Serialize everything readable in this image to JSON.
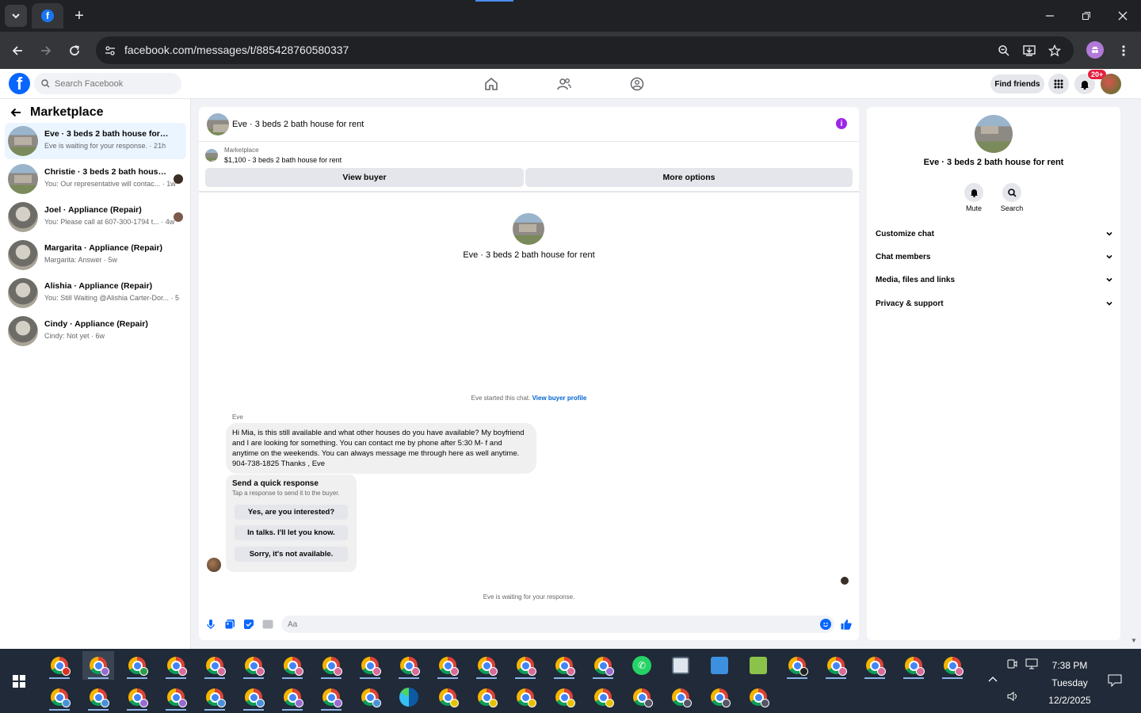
{
  "browser": {
    "url": "facebook.com/messages/t/885428760580337",
    "new_tab": "+"
  },
  "fb_header": {
    "search_placeholder": "Search Facebook",
    "find_friends": "Find friends",
    "notification_badge": "20+"
  },
  "sidebar": {
    "title": "Marketplace",
    "conversations": [
      {
        "name": "Eve · 3 beds 2 bath house for rent",
        "preview": "Eve is waiting for your response. · 21h",
        "avatar": "house"
      },
      {
        "name": "Christie · 3 beds 2 bath house fo...",
        "preview": "You: Our representative will contac... · 1w",
        "avatar": "house"
      },
      {
        "name": "Joel · Appliance (Repair)",
        "preview": "You: Please call at 607-300-1794 t... · 4w",
        "avatar": "appliance"
      },
      {
        "name": "Margarita · Appliance (Repair)",
        "preview": "Margarita: Answer · 5w",
        "avatar": "appliance"
      },
      {
        "name": "Alishia · Appliance (Repair)",
        "preview": "You: Still Waiting @Alishia Carter-Dor... · 5w",
        "avatar": "appliance"
      },
      {
        "name": "Cindy · Appliance (Repair)",
        "preview": "Cindy: Not yet · 6w",
        "avatar": "appliance"
      }
    ]
  },
  "chat": {
    "title": "Eve · 3 beds 2 bath house for rent",
    "marketplace_label": "Marketplace",
    "listing": "$1,100 - 3 beds 2 bath house for rent",
    "view_buyer": "View buyer",
    "more_options": "More options",
    "intro_title": "Eve · 3 beds 2 bath house for rent",
    "started_text": "Eve started this chat.",
    "view_buyer_profile": "View buyer profile",
    "sender": "Eve",
    "message": "Hi Mia, is this still available and what other houses do you have available? My boyfriend and I are looking for something. You can contact me by phone after 5:30 M- f and anytime on the weekends. You can always message me through here as well anytime. 904-738-1825  Thanks , Eve",
    "quick_title": "Send a quick response",
    "quick_sub": "Tap a response to send it to the buyer.",
    "quick_replies": [
      "Yes, are you interested?",
      "In talks. I'll let you know.",
      "Sorry, it's not available."
    ],
    "waiting": "Eve is waiting for your response.",
    "composer_placeholder": "Aa",
    "gif_label": "GIF"
  },
  "right_panel": {
    "name": "Eve · 3 beds 2 bath house for rent",
    "mute": "Mute",
    "search": "Search",
    "sections": [
      "Customize chat",
      "Chat members",
      "Media, files and links",
      "Privacy & support"
    ]
  },
  "taskbar": {
    "time": "7:38 PM",
    "day": "Tuesday",
    "date": "12/2/2025"
  },
  "colors": {
    "fb_blue": "#0866ff",
    "info_purple": "#9c27e8",
    "badge_red": "#e41e3f",
    "active_conv": "#ebf5ff"
  }
}
